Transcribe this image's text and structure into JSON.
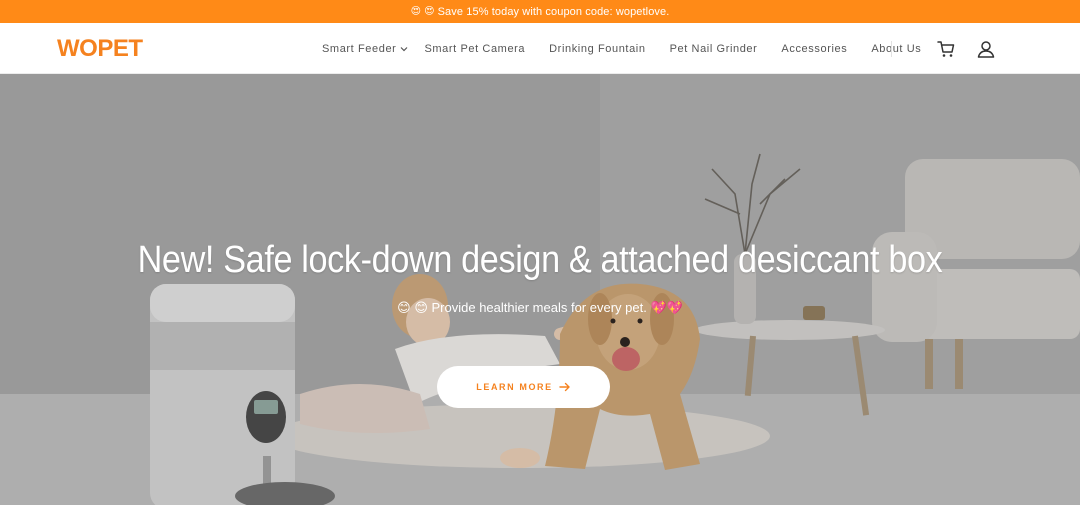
{
  "announcement": {
    "emoji_1": "😍",
    "emoji_2": "😍",
    "text": "Save 15% today with coupon code: wopetlove."
  },
  "header": {
    "logo": "WOPET",
    "nav": [
      {
        "label": "Smart Feeder",
        "has_dropdown": true
      },
      {
        "label": "Smart Pet Camera"
      },
      {
        "label": "Drinking Fountain"
      },
      {
        "label": "Pet Nail Grinder"
      },
      {
        "label": "Accessories"
      },
      {
        "label": "About Us"
      }
    ],
    "icons": [
      "cart-icon",
      "account-icon"
    ]
  },
  "hero": {
    "title": "New! Safe lock-down design & attached desiccant box",
    "subtitle_emoji_left": "😊 😊",
    "subtitle": "Provide healthier meals for every pet.",
    "subtitle_emoji_right": "💖💖",
    "cta_label": "LEARN MORE",
    "image_icon": "feeder-dog-girl-photo"
  },
  "colors": {
    "brand_orange": "#f5821f",
    "announcement_bg": "#ff8a17",
    "nav_text": "#555555",
    "hero_text": "#ffffff"
  }
}
